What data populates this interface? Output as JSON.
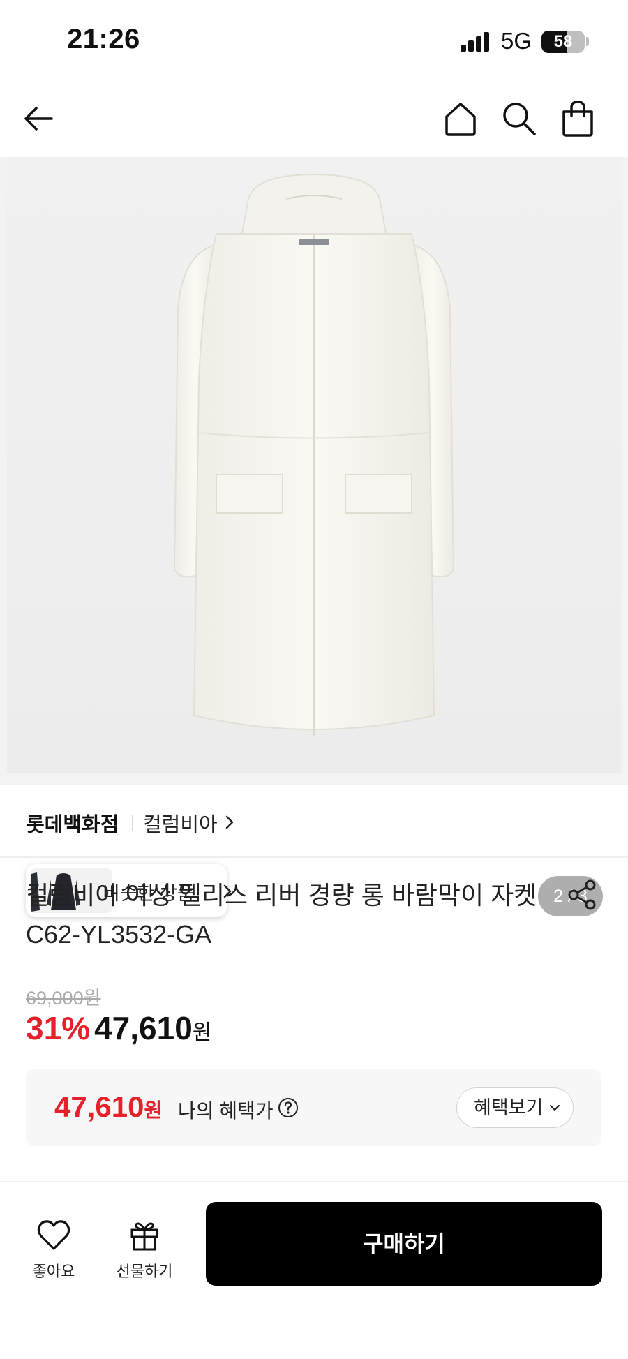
{
  "status_bar": {
    "time": "21:26",
    "network": "5G",
    "battery_level": "58",
    "battery_fraction": 0.58
  },
  "header": {
    "icons": [
      "back-arrow-icon",
      "home-icon",
      "search-icon",
      "shopping-bag-icon"
    ]
  },
  "gallery": {
    "similar_label": "비슷한 상품",
    "pager": "2 / 3",
    "background_color": "#efefef"
  },
  "brand": {
    "store": "롯데백화점",
    "name": "컬럼비아"
  },
  "product": {
    "title_line1": "컬럼비아 여성 엘리스 리버 경량 롱 바람막이 자켓",
    "title_line2": "C62-YL3532-GA"
  },
  "price": {
    "original": "69,000원",
    "discount": "31%",
    "sale_amount": "47,610",
    "sale_unit": "원"
  },
  "benefit": {
    "amount": "47,610",
    "unit": "원",
    "label": "나의 혜택가",
    "button_label": "혜택보기"
  },
  "bottom_bar": {
    "like_label": "좋아요",
    "gift_label": "선물하기",
    "buy_label": "구매하기"
  },
  "colors": {
    "accent_red": "#e5212b",
    "buy_button": "#000000"
  }
}
